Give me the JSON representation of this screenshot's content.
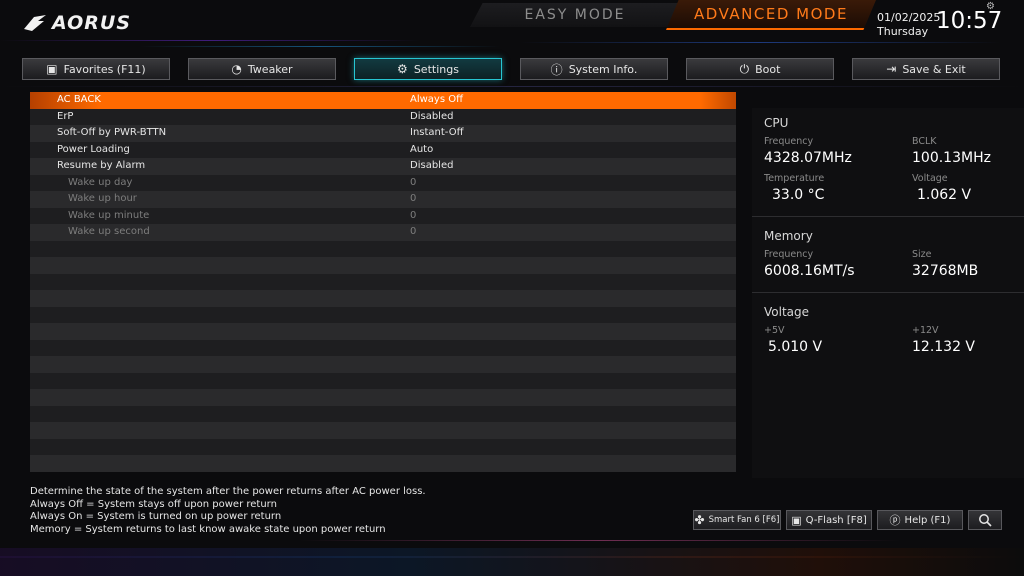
{
  "header": {
    "logo_text": "AORUS",
    "easy_mode": "EASY MODE",
    "advanced_mode": "ADVANCED MODE",
    "date": "01/02/2025",
    "day": "Thursday",
    "time": "10:57"
  },
  "tabs": [
    {
      "label": "Favorites (F11)",
      "icon": "star-icon"
    },
    {
      "label": "Tweaker",
      "icon": "speedometer-icon"
    },
    {
      "label": "Settings",
      "icon": "gear-icon"
    },
    {
      "label": "System Info.",
      "icon": "info-icon"
    },
    {
      "label": "Boot",
      "icon": "power-icon"
    },
    {
      "label": "Save & Exit",
      "icon": "exit-icon"
    }
  ],
  "settings": [
    {
      "name": "AC BACK",
      "value": "Always Off"
    },
    {
      "name": "ErP",
      "value": "Disabled"
    },
    {
      "name": "Soft-Off by PWR-BTTN",
      "value": "Instant-Off"
    },
    {
      "name": "Power Loading",
      "value": "Auto"
    },
    {
      "name": "Resume by Alarm",
      "value": "Disabled"
    },
    {
      "name": "Wake up day",
      "value": "0"
    },
    {
      "name": "Wake up hour",
      "value": "0"
    },
    {
      "name": "Wake up minute",
      "value": "0"
    },
    {
      "name": "Wake up second",
      "value": "0"
    }
  ],
  "panel": {
    "cpu": {
      "title": "CPU",
      "freq_label": "Frequency",
      "freq": "4328.07MHz",
      "bclk_label": "BCLK",
      "bclk": "100.13MHz",
      "temp_label": "Temperature",
      "temp": "33.0 °C",
      "volt_label": "Voltage",
      "volt": "1.062 V"
    },
    "memory": {
      "title": "Memory",
      "freq_label": "Frequency",
      "freq": "6008.16MT/s",
      "size_label": "Size",
      "size": "32768MB"
    },
    "voltage": {
      "title": "Voltage",
      "v5_label": "+5V",
      "v5": "5.010 V",
      "v12_label": "+12V",
      "v12": "12.132 V"
    }
  },
  "help": {
    "line1": "Determine the state of  the system after the power returns after AC power loss.",
    "line2": "Always Off = System stays off upon power return",
    "line3": "Always On = System is turned on up power return",
    "line4": "Memory = System returns to last know awake state upon power return"
  },
  "buttons": {
    "smartfan": "Smart Fan 6 [F6]",
    "qflash": "Q-Flash [F8]",
    "help": "Help (F1)"
  },
  "colors": {
    "accent_orange": "#ff6a00",
    "tab_active": "#27c6d3"
  }
}
